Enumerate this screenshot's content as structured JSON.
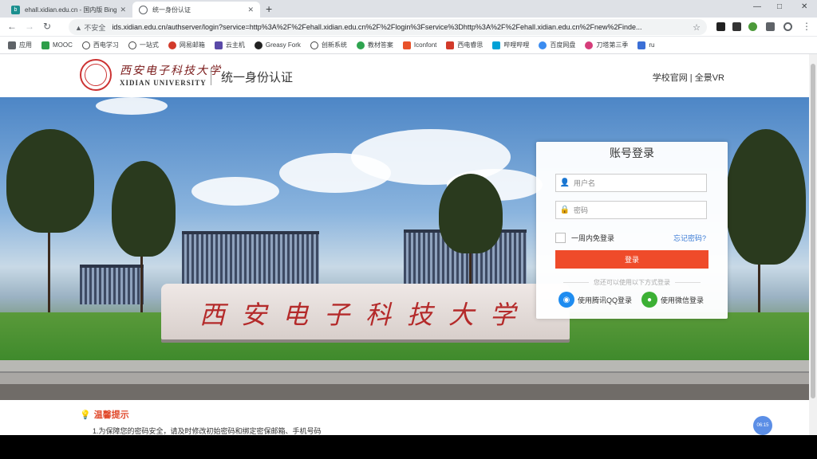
{
  "browser": {
    "tabs": [
      {
        "title": "ehall.xidian.edu.cn - 国内版 Bing",
        "favicon_color": "#1b8f8f"
      },
      {
        "title": "统一身份认证",
        "favicon_color": "#5f6368"
      }
    ],
    "new_tab_symbol": "+",
    "window_controls": [
      "—",
      "□",
      "✕"
    ],
    "security_label": "不安全",
    "url": "ids.xidian.edu.cn/authserver/login?service=http%3A%2F%2Fehall.xidian.edu.cn%2F%2Flogin%3Fservice%3Dhttp%3A%2F%2Fehall.xidian.edu.cn%2Fnew%2Finde...",
    "bookmarks": [
      {
        "label": "应用",
        "color": "#5f6368"
      },
      {
        "label": "MOOC",
        "color": "#2e9e4a"
      },
      {
        "label": "西电学习",
        "color": "#444444"
      },
      {
        "label": "一站式",
        "color": "#444444"
      },
      {
        "label": "网易邮箱",
        "color": "#d23a2a"
      },
      {
        "label": "云主机",
        "color": "#5a4aa8"
      },
      {
        "label": "Greasy Fork",
        "color": "#222222"
      },
      {
        "label": "创新系统",
        "color": "#444444"
      },
      {
        "label": "教材答案",
        "color": "#2ea44f"
      },
      {
        "label": "Iconfont",
        "color": "#e8522a"
      },
      {
        "label": "西电睿思",
        "color": "#d23a2a"
      },
      {
        "label": "哔哩哔哩",
        "color": "#00a1d6"
      },
      {
        "label": "百度网盘",
        "color": "#3b8cf0"
      },
      {
        "label": "刀塔第三季",
        "color": "#d63d7a"
      },
      {
        "label": "ru",
        "color": "#3b6fd6"
      }
    ]
  },
  "site": {
    "logo_cn": "西安电子科技大学",
    "logo_en": "XIDIAN UNIVERSITY",
    "system_name": "统一身份认证",
    "header_links": [
      "学校官网",
      "全景VR"
    ],
    "header_separator": "|"
  },
  "hero": {
    "stone_inscription": "西安电子科技大学"
  },
  "login": {
    "title": "账号登录",
    "username_placeholder": "用户名",
    "password_placeholder": "密码",
    "remember_label": "一周内免登录",
    "forgot_label": "忘记密码?",
    "submit_label": "登录",
    "alt_methods_label": "您还可以使用以下方式登录",
    "qq_label": "使用腾讯QQ登录",
    "wechat_label": "使用微信登录"
  },
  "notice": {
    "title": "温馨提示",
    "items": [
      "1.为保障您的密码安全，请及时修改初始密码和绑定密保邮箱、手机号码"
    ]
  },
  "float_badge": "06:15"
}
